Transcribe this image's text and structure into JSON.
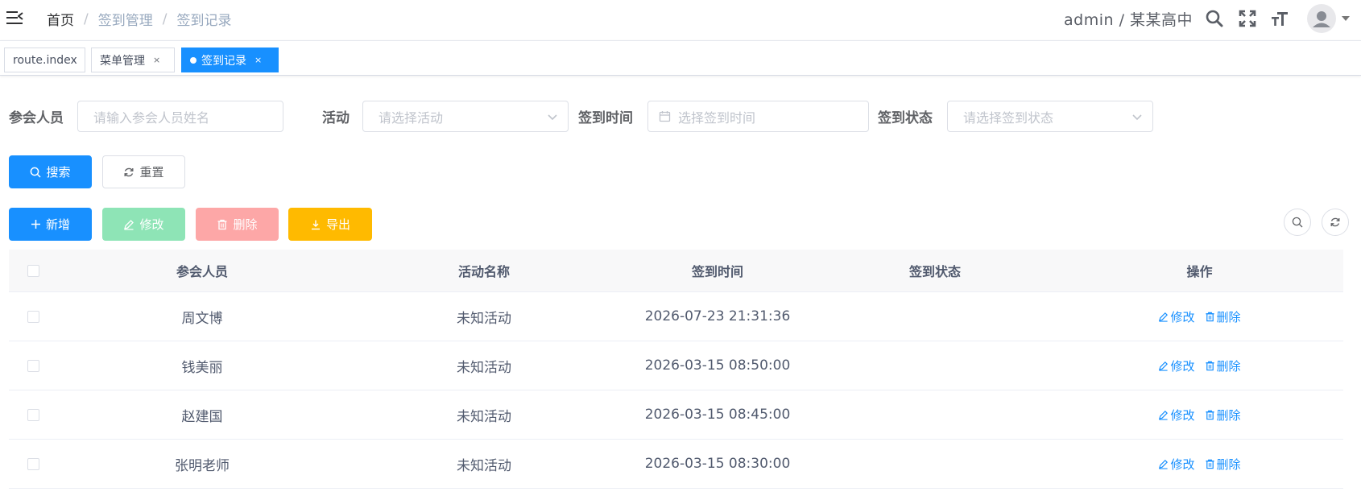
{
  "breadcrumb": {
    "home": "首页",
    "section": "签到管理",
    "page": "签到记录",
    "separator": "/"
  },
  "header": {
    "user_text": "admin / 某某高中"
  },
  "tags": {
    "items": [
      {
        "label": "route.index"
      },
      {
        "label": "菜单管理",
        "close": "×"
      },
      {
        "label": "签到记录",
        "close": "×"
      }
    ]
  },
  "search": {
    "attendee_label": "参会人员",
    "attendee_placeholder": "请输入参会人员姓名",
    "activity_label": "活动",
    "activity_placeholder": "请选择活动",
    "time_label": "签到时间",
    "time_placeholder": "选择签到时间",
    "status_label": "签到状态",
    "status_placeholder": "请选择签到状态",
    "search_button": "搜索",
    "reset_button": "重置"
  },
  "toolbar": {
    "add": "新增",
    "edit": "修改",
    "delete": "删除",
    "export": "导出"
  },
  "table": {
    "columns": [
      "参会人员",
      "活动名称",
      "签到时间",
      "签到状态",
      "操作"
    ],
    "rows": [
      {
        "name": "周文博",
        "activity": "未知活动",
        "time": "2026-07-23 21:31:36",
        "status": ""
      },
      {
        "name": "钱美丽",
        "activity": "未知活动",
        "time": "2026-03-15 08:50:00",
        "status": ""
      },
      {
        "name": "赵建国",
        "activity": "未知活动",
        "time": "2026-03-15 08:45:00",
        "status": ""
      },
      {
        "name": "张明老师",
        "activity": "未知活动",
        "time": "2026-03-15 08:30:00",
        "status": ""
      }
    ],
    "row_edit": "修改",
    "row_delete": "删除"
  },
  "colors": {
    "primary": "#1890ff",
    "success_disabled": "#8ee4b6",
    "danger_disabled": "#fda7a7",
    "warning": "#ffba00"
  }
}
